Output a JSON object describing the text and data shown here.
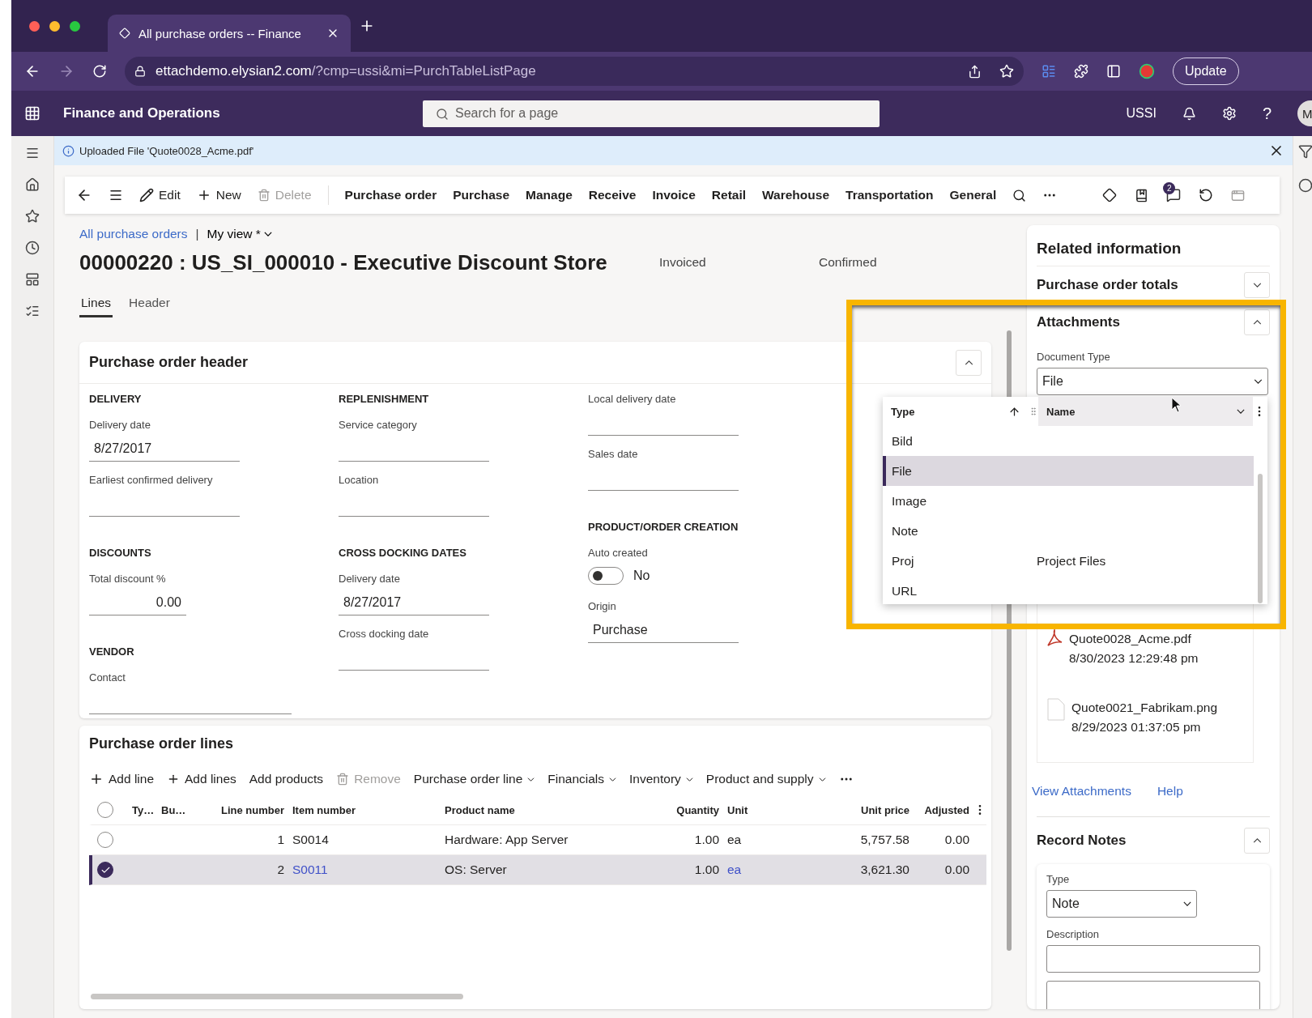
{
  "browser": {
    "tab_title": "All purchase orders -- Finance",
    "url_host": "ettachdemo.elysian2.com",
    "url_path": "/?cmp=ussi&mi=PurchTableListPage",
    "update_button": "Update"
  },
  "app_bar": {
    "title": "Finance and Operations",
    "search": {
      "placeholder": "Search for a page"
    },
    "company": "USSI",
    "help": "?",
    "avatar": "M"
  },
  "info_bar": {
    "message": "Uploaded File 'Quote0028_Acme.pdf'"
  },
  "toolbar": {
    "actions": [
      {
        "label": "Edit",
        "kind": "edit",
        "disabled": false
      },
      {
        "label": "New",
        "kind": "new",
        "disabled": false
      },
      {
        "label": "Delete",
        "kind": "delete",
        "disabled": true
      }
    ],
    "menus": [
      "Purchase order",
      "Purchase",
      "Manage",
      "Receive",
      "Invoice",
      "Retail",
      "Warehouse",
      "Transportation",
      "General"
    ],
    "notification_count": "2"
  },
  "breadcrumb": {
    "link": "All purchase orders",
    "separator": "|",
    "view": "My view *"
  },
  "title": "00000220 : US_SI_000010 - Executive Discount Store",
  "statuses": [
    "Invoiced",
    "Confirmed"
  ],
  "tabs": [
    {
      "label": "Lines",
      "selected": true
    },
    {
      "label": "Header",
      "selected": false
    }
  ],
  "header_card": {
    "title": "Purchase order header",
    "expanded": true,
    "columns": [
      [
        {
          "kind": "heading",
          "text": "DELIVERY"
        },
        {
          "kind": "field",
          "label": "Delivery date",
          "value": "8/27/2017"
        },
        {
          "kind": "field",
          "label": "Earliest confirmed delivery"
        },
        {
          "kind": "heading",
          "text": "DISCOUNTS"
        },
        {
          "kind": "number",
          "label": "Total discount %",
          "value": "0.00"
        },
        {
          "kind": "heading",
          "text": "VENDOR"
        },
        {
          "kind": "wide",
          "label": "Contact"
        }
      ],
      [
        {
          "kind": "heading",
          "text": "REPLENISHMENT"
        },
        {
          "kind": "field",
          "label": "Service category"
        },
        {
          "kind": "field",
          "label": "Location"
        },
        {
          "kind": "heading",
          "text": "CROSS DOCKING DATES"
        },
        {
          "kind": "field",
          "label": "Delivery date",
          "value": "8/27/2017"
        },
        {
          "kind": "field",
          "label": "Cross docking date"
        }
      ],
      [
        {
          "kind": "field",
          "label": "Local delivery date"
        },
        {
          "kind": "field",
          "label": "Sales date"
        },
        {
          "kind": "heading",
          "text": "PRODUCT/ORDER CREATION"
        },
        {
          "kind": "toggle",
          "label": "Auto created",
          "on": false,
          "value": "No"
        },
        {
          "kind": "field",
          "label": "Origin",
          "value": "Purchase"
        }
      ]
    ]
  },
  "lines_card": {
    "title": "Purchase order lines",
    "actions": [
      {
        "label": "Add line",
        "kind": "add",
        "disabled": false
      },
      {
        "label": "Add lines",
        "kind": "add-many",
        "disabled": false
      },
      {
        "label": "Add products",
        "kind": "plain",
        "disabled": false
      },
      {
        "label": "Remove",
        "kind": "delete",
        "disabled": true
      },
      {
        "label": "Purchase order line",
        "kind": "menu",
        "disabled": false
      },
      {
        "label": "Financials",
        "kind": "menu",
        "disabled": false
      },
      {
        "label": "Inventory",
        "kind": "menu",
        "disabled": false
      },
      {
        "label": "Product and supply",
        "kind": "menu",
        "disabled": false
      }
    ],
    "select_all": {
      "checked": false
    },
    "columns": [
      "Ty…",
      "Bu…",
      "Line number",
      "Item number",
      "Product name",
      "Quantity",
      "Unit",
      "Unit price",
      "Adjusted"
    ],
    "rows": [
      {
        "selected": false,
        "cells": [
          {
            "text": ""
          },
          {
            "text": ""
          },
          {
            "text": "1",
            "link": false
          },
          {
            "text": "S0014",
            "link": false
          },
          {
            "text": "Hardware: App Server",
            "link": false
          },
          {
            "text": "1.00",
            "link": false
          },
          {
            "text": "ea",
            "link": false
          },
          {
            "text": "5,757.58",
            "link": false
          },
          {
            "text": "0.00",
            "link": false
          }
        ]
      },
      {
        "selected": true,
        "cells": [
          {
            "text": ""
          },
          {
            "text": ""
          },
          {
            "text": "2",
            "link": false
          },
          {
            "text": "S0011",
            "link": true
          },
          {
            "text": "OS: Server",
            "link": false
          },
          {
            "text": "1.00",
            "link": false
          },
          {
            "text": "ea",
            "link": true
          },
          {
            "text": "3,621.30",
            "link": false
          },
          {
            "text": "0.00",
            "link": false
          }
        ]
      }
    ]
  },
  "related": {
    "title": "Related information",
    "totals": {
      "title": "Purchase order totals",
      "expanded": false
    },
    "attachments": {
      "title": "Attachments",
      "expanded": true,
      "document_type_label": "Document Type",
      "document_type": "File",
      "files": [
        {
          "name": "Quote0028_Acme.pdf",
          "date": "8/30/2023 12:29:48 pm",
          "kind": "pdf"
        },
        {
          "name": "Quote0021_Fabrikam.png",
          "date": "8/29/2023 01:37:05 pm",
          "kind": "blank"
        }
      ],
      "links": [
        "View Attachments",
        "Help"
      ]
    },
    "notes": {
      "title": "Record Notes",
      "expanded": true,
      "type_label": "Type",
      "type": "Note",
      "description_label": "Description"
    }
  },
  "dropdown": {
    "columns": [
      "Type",
      "Name"
    ],
    "options": [
      {
        "type": "Bild",
        "selected": false
      },
      {
        "type": "File",
        "selected": true
      },
      {
        "type": "Image",
        "selected": false
      },
      {
        "type": "Note",
        "selected": false
      },
      {
        "type": "Proj",
        "name": "Project Files",
        "selected": false
      },
      {
        "type": "URL",
        "selected": false
      }
    ]
  }
}
